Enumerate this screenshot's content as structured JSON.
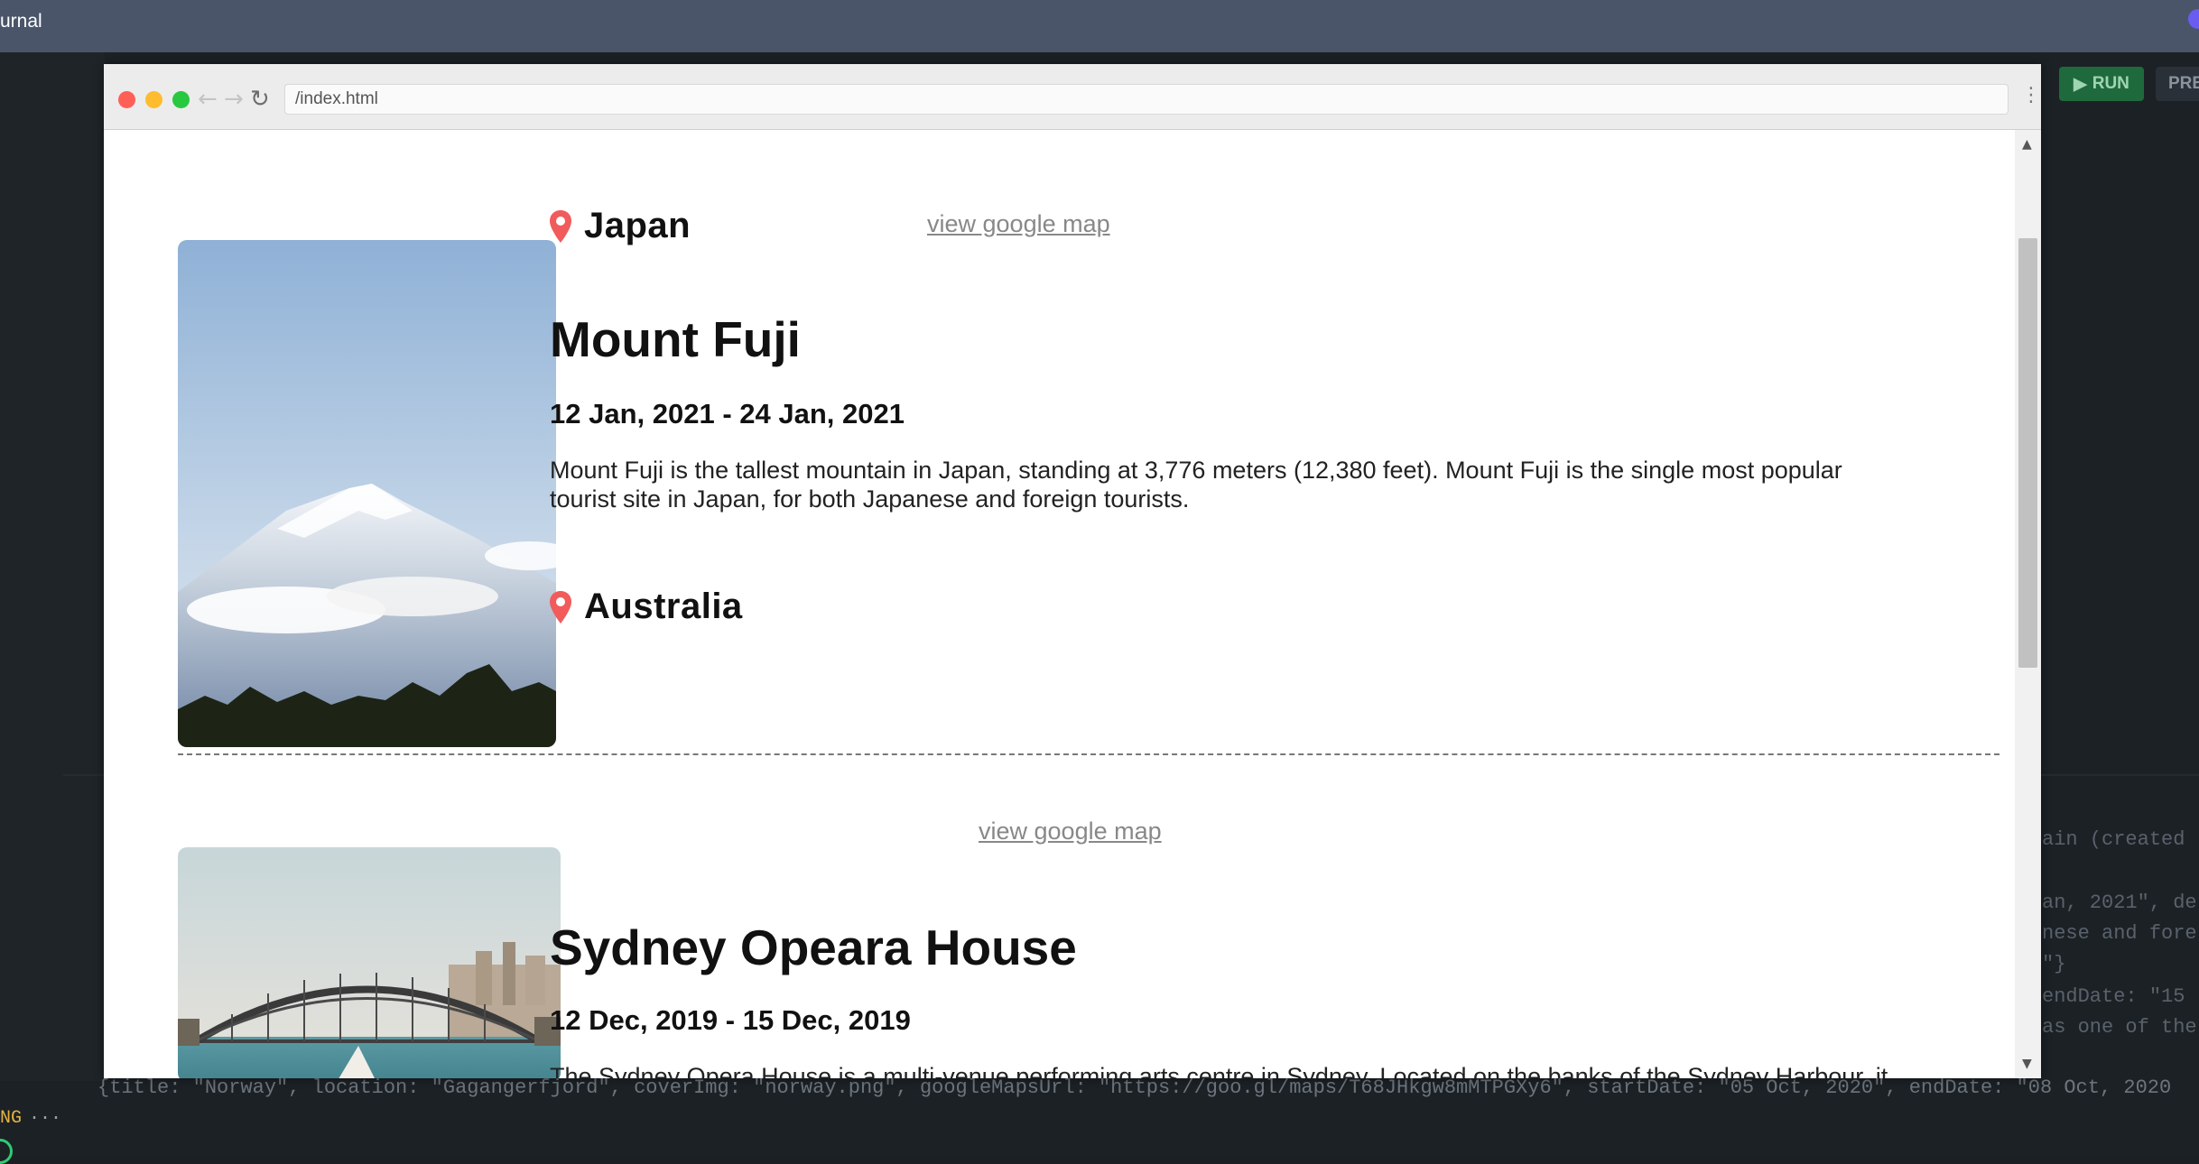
{
  "app": {
    "topbar_title": "urnal",
    "run_label": "RUN",
    "prev_label": "PRE",
    "status_text": "NG",
    "status_ellipsis": "···",
    "code_lines": {
      "l1": "ain (created",
      "l2": "an, 2021\", de",
      "l3": "nese and fore",
      "l4": "\"}",
      "l5": "endDate: \"15",
      "l6": "as one of the",
      "bottom": "{title: \"Norway\", location: \"Gagangerfjord\", coverImg: \"norway.png\", googleMapsUrl: \"https://goo.gl/maps/T68JHkgw8mMTPGXy6\", startDate: \"05 Oct, 2020\", endDate: \"08 Oct, 2020"
    }
  },
  "browser": {
    "url": "/index.html",
    "back_icon": "arrow-left",
    "forward_icon": "arrow-right",
    "reload_icon": "reload"
  },
  "entries": [
    {
      "location": "Japan",
      "map_link": "view google map",
      "title": "Mount Fuji",
      "dates": "12 Jan, 2021 - 24 Jan, 2021",
      "description": "Mount Fuji is the tallest mountain in Japan, standing at 3,776 meters (12,380 feet). Mount Fuji is the single most popular tourist site in Japan, for both Japanese and foreign tourists."
    },
    {
      "location": "Australia",
      "map_link": "view google map",
      "title": "Sydney Opeara House",
      "dates": "12 Dec, 2019 - 15 Dec, 2019",
      "description": "The Sydney Opera House is a multi-venue performing arts centre in Sydney. Located on the banks of the Sydney Harbour, it is"
    }
  ],
  "colors": {
    "pin": "#f15b5b",
    "topbar": "#4a5569",
    "run_button": "#1f6a3d"
  }
}
